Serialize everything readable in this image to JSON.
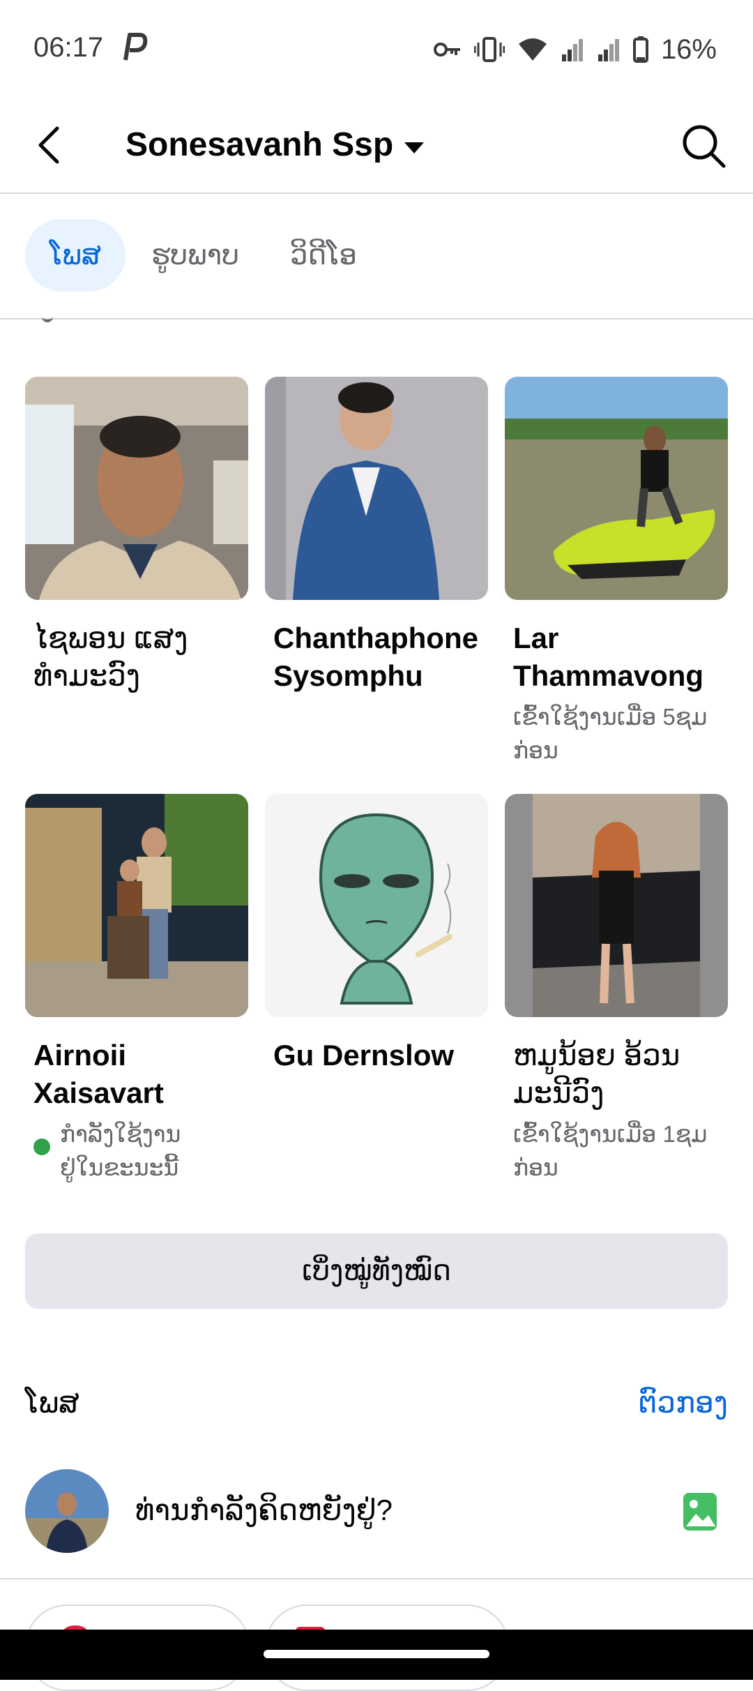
{
  "status": {
    "time": "06:17",
    "battery": "16%"
  },
  "header": {
    "title": "Sonesavanh Ssp"
  },
  "tabs": [
    {
      "label": "ໂພສ",
      "active": true
    },
    {
      "label": "ຮູບພາບ",
      "active": false
    },
    {
      "label": "ວິດີໂອ",
      "active": false
    }
  ],
  "friends": [
    {
      "name": "ໄຊພອນ ແສງທຳມະວົງ",
      "sub": ""
    },
    {
      "name": "Chanthaphone Sysomphu",
      "sub": ""
    },
    {
      "name": "Lar Thammavong",
      "sub": "ເຂົ້າໃຊ້ງານເມື່ອ 5ຊມ ກ່ອນ"
    },
    {
      "name": "Airnoii Xaisavart",
      "sub": "ກຳລັງໃຊ້ງານຢູ່ໃນຂະນະນີ້"
    },
    {
      "name": "Gu Dernslow",
      "sub": ""
    },
    {
      "name": "ຫມູນ້ອຍ ອ້ວນມະນີວົງ",
      "sub": "ເຂົ້າໃຊ້ງານເມື່ອ 1ຊມ ກ່ອນ"
    }
  ],
  "see_all": "ເບິ່ງໝູ່ທັງໝົດ",
  "posts": {
    "title": "ໂພສ",
    "filter": "ຕົວກອງ"
  },
  "composer": {
    "placeholder": "ທ່ານກຳລັງຄິດຫຍັງຢູ່?"
  },
  "colors": {
    "accent": "#0866d9",
    "online": "#31a24c",
    "photo_icon": "#45bd62"
  }
}
